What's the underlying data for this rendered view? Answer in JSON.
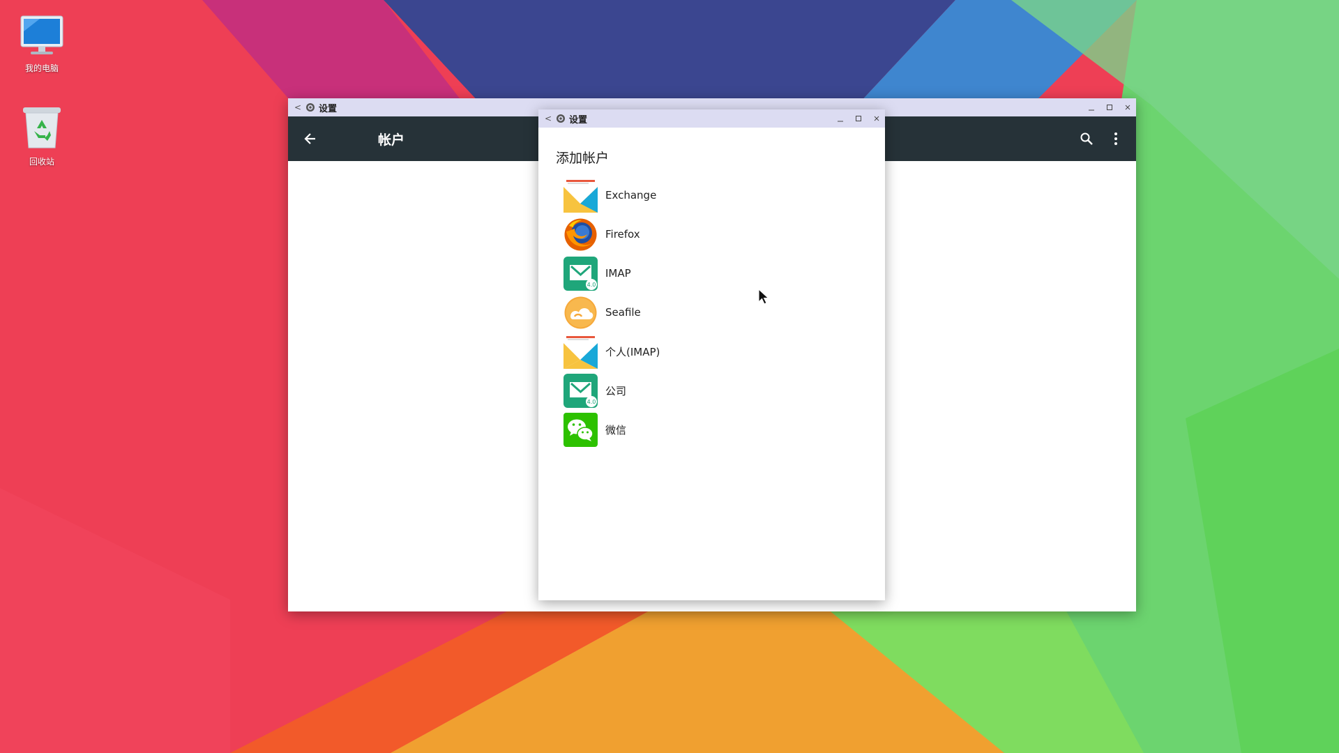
{
  "desktop": {
    "icons": [
      {
        "label": "我的电脑",
        "icon": "computer-icon"
      },
      {
        "label": "回收站",
        "icon": "recycle-bin-icon"
      }
    ]
  },
  "main_window": {
    "title": "设置",
    "toolbar_title": "帐户",
    "icons": [
      "back-arrow-icon",
      "search-icon",
      "more-vert-icon"
    ]
  },
  "dialog": {
    "window_title": "设置",
    "heading": "添加帐户",
    "accounts": [
      {
        "name": "Exchange",
        "icon": "exchange-mail-icon"
      },
      {
        "name": "Firefox",
        "icon": "firefox-icon"
      },
      {
        "name": "IMAP",
        "icon": "imap-mail-icon"
      },
      {
        "name": "Seafile",
        "icon": "seafile-icon"
      },
      {
        "name": "个人(IMAP)",
        "icon": "personal-imap-mail-icon"
      },
      {
        "name": "公司",
        "icon": "company-mail-icon"
      },
      {
        "name": "微信",
        "icon": "wechat-icon"
      }
    ]
  },
  "colors": {
    "titlebar": "#dcdcf2",
    "appbar": "#263238",
    "wechat_green": "#2dc100",
    "mail_teal": "#1fa67a"
  }
}
